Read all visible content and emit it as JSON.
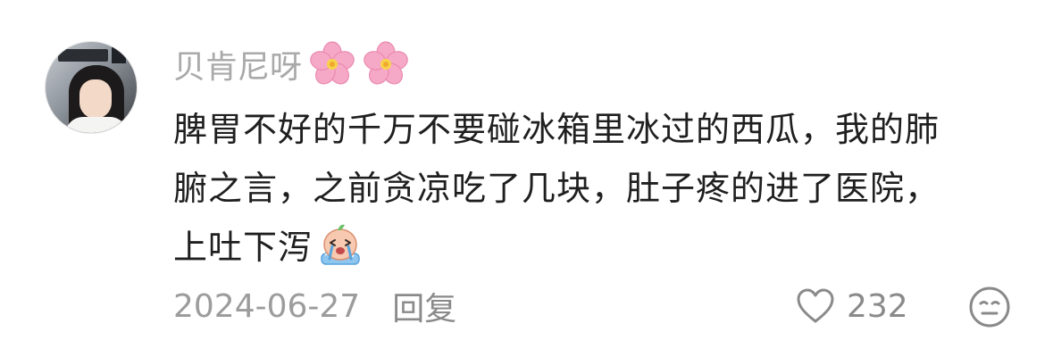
{
  "comment": {
    "username": "贝肯尼呀",
    "username_emojis": [
      "cherry-blossom-emoji",
      "cherry-blossom-emoji"
    ],
    "text_lines": [
      "脾胃不好的千万不要碰冰箱里冰过的西瓜，我的肺",
      "腑之言，之前贪凉吃了几块，肚子疼的进了医院，",
      "上吐下泻"
    ],
    "trailing_emoji": "crying-emoji",
    "date": "2024-06-27",
    "reply_label": "回复",
    "like_count": "232",
    "like_icon": "heart-outline-icon",
    "reaction_icon": "meh-face-icon"
  },
  "colors": {
    "username": "#a9a9a9",
    "body_text": "#1f1f1f",
    "meta_text": "#9c9c9c",
    "flower_pink": "#f6a9c6"
  }
}
